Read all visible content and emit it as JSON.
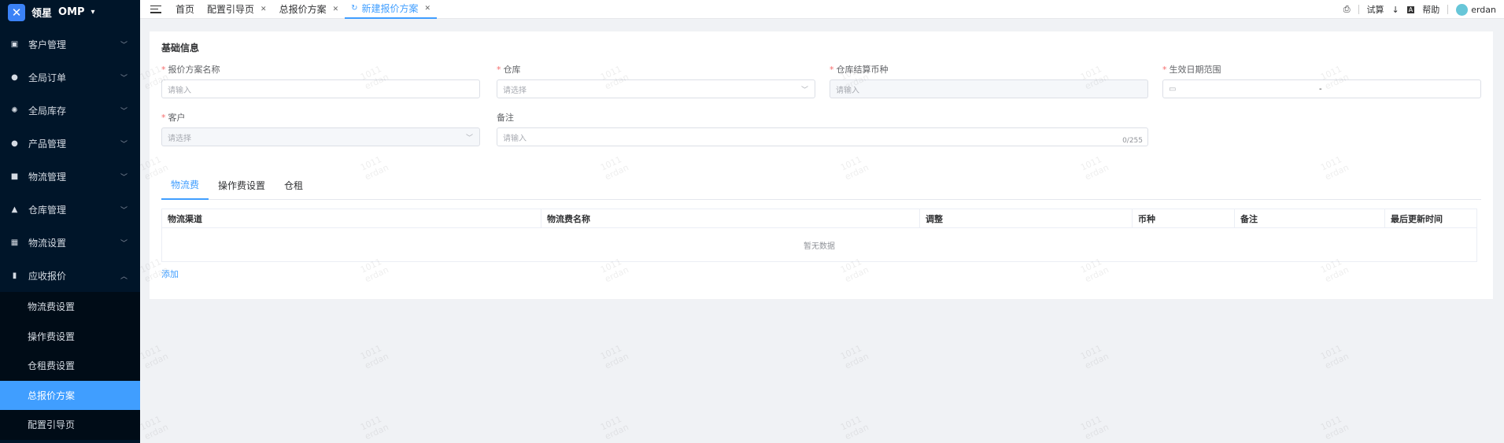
{
  "app": {
    "brand": "领星",
    "product": "OMP"
  },
  "sidebar": {
    "items": [
      {
        "label": "客户管理",
        "icon": "user-card-icon"
      },
      {
        "label": "全局订单",
        "icon": "person-icon"
      },
      {
        "label": "全局库存",
        "icon": "gear-icon"
      },
      {
        "label": "产品管理",
        "icon": "person-icon"
      },
      {
        "label": "物流管理",
        "icon": "truck-icon"
      },
      {
        "label": "仓库管理",
        "icon": "warehouse-icon"
      },
      {
        "label": "物流设置",
        "icon": "settings-box-icon"
      },
      {
        "label": "应收报价",
        "icon": "receipt-icon",
        "expanded": true
      }
    ],
    "subitems": [
      {
        "label": "物流费设置"
      },
      {
        "label": "操作费设置"
      },
      {
        "label": "仓租费设置"
      },
      {
        "label": "总报价方案",
        "active": true
      },
      {
        "label": "配置引导页"
      }
    ]
  },
  "topbar": {
    "tabs": [
      {
        "label": "首页",
        "closable": false
      },
      {
        "label": "配置引导页",
        "closable": true
      },
      {
        "label": "总报价方案",
        "closable": true
      },
      {
        "label": "新建报价方案",
        "closable": true,
        "active": true
      }
    ],
    "trial": "试算",
    "help": "帮助",
    "username": "erdan"
  },
  "basic": {
    "title": "基础信息",
    "fields": {
      "plan_name": {
        "label": "报价方案名称",
        "placeholder": "请输入",
        "required": true
      },
      "warehouse": {
        "label": "仓库",
        "placeholder": "请选择",
        "required": true
      },
      "currency": {
        "label": "仓库结算币种",
        "placeholder": "请输入",
        "required": true
      },
      "date_range": {
        "label": "生效日期范围",
        "separator": "-",
        "required": true
      },
      "customer": {
        "label": "客户",
        "placeholder": "请选择",
        "required": true
      },
      "remark": {
        "label": "备注",
        "placeholder": "请输入",
        "counter": "0/255"
      }
    }
  },
  "fees": {
    "tabs": [
      "物流费",
      "操作费设置",
      "仓租"
    ],
    "columns": [
      "物流渠道",
      "物流费名称",
      "调整",
      "币种",
      "备注",
      "最后更新时间"
    ],
    "empty": "暂无数据",
    "add_label": "添加"
  },
  "watermark": {
    "line1": "1011",
    "line2": "erdan"
  }
}
